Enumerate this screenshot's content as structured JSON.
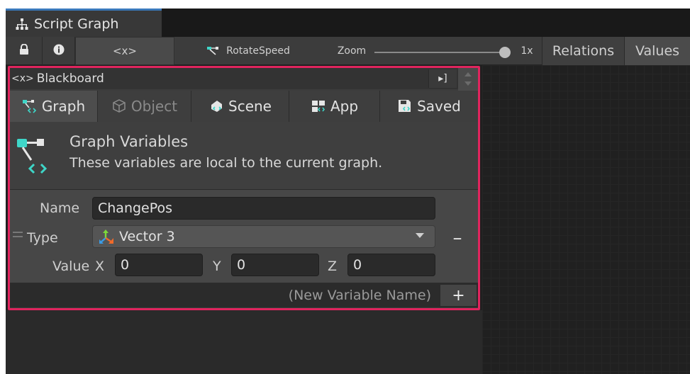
{
  "window": {
    "tab_title": "Script Graph"
  },
  "toolbar": {
    "var_button_label": "<x>",
    "breadcrumb": "RotateSpeed",
    "zoom_label": "Zoom",
    "zoom_value": "1x",
    "zoom_level": 1.0,
    "relations_label": "Relations",
    "values_label": "Values"
  },
  "blackboard": {
    "title": "Blackboard",
    "title_prefix": "<x>",
    "dock_label": "▸]",
    "tabs": [
      {
        "label": "Graph",
        "icon": "graph-icon",
        "active": true
      },
      {
        "label": "Object",
        "icon": "object-icon",
        "active": false,
        "disabled": true
      },
      {
        "label": "Scene",
        "icon": "scene-icon",
        "active": false
      },
      {
        "label": "App",
        "icon": "app-icon",
        "active": false
      },
      {
        "label": "Saved",
        "icon": "saved-icon",
        "active": false
      }
    ],
    "info": {
      "title": "Graph Variables",
      "description": "These variables are local to the current graph."
    },
    "variable": {
      "name_label": "Name",
      "name_value": "ChangePos",
      "type_label": "Type",
      "type_value": "Vector 3",
      "value_label": "Value",
      "x_label": "X",
      "x_value": "0",
      "y_label": "Y",
      "y_value": "0",
      "z_label": "Z",
      "z_value": "0",
      "remove_label": "–"
    },
    "new_variable": {
      "placeholder": "(New Variable Name)",
      "add_label": "+"
    }
  },
  "colors": {
    "highlight_border": "#e0245e",
    "tab_accent": "#3a79bb",
    "graph_icon_teal": "#3ed6c8"
  }
}
